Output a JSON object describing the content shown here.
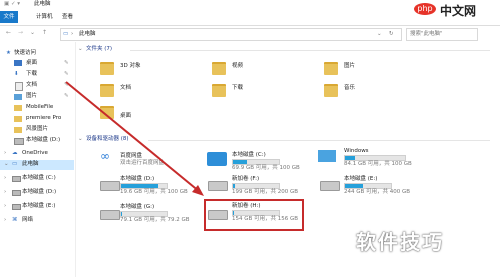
{
  "window": {
    "title": "此电脑",
    "controls": [
      "—",
      "□",
      "✕"
    ]
  },
  "ribbon": {
    "tabs": [
      "文件",
      "计算机",
      "查看"
    ]
  },
  "address": {
    "path": "此电脑",
    "search_placeholder": "搜索\"此电脑\""
  },
  "sidebar": {
    "quick_access": "快速访问",
    "items": [
      "桌面",
      "下载",
      "文档",
      "图片",
      "MobileFile",
      "premiere Pro",
      "风景图片",
      "本地磁盘 (D:)"
    ],
    "onedrive": "OneDrive",
    "this_pc": "此电脑",
    "drives": [
      "本地磁盘 (C:)",
      "本地磁盘 (D:)",
      "本地磁盘 (E:)"
    ],
    "network": "网络"
  },
  "folders_section": "文件夹 (7)",
  "folders": [
    {
      "name": "3D 对象"
    },
    {
      "name": "视频"
    },
    {
      "name": "图片"
    },
    {
      "name": "文档"
    },
    {
      "name": "下载"
    },
    {
      "name": "音乐"
    },
    {
      "name": "桌面"
    }
  ],
  "devices_section": "设备和驱动器 (8)",
  "devices": [
    {
      "name": "百度网盘",
      "sub": "双击运行百度网盘"
    },
    {
      "name": "本地磁盘 (C:)",
      "free": "69.9 GB 可用，共 100 GB",
      "fill": 0.3
    },
    {
      "name": "Windows",
      "free": "84.1 GB 可用，共 100 GB",
      "fill": 0.16
    },
    {
      "name": "本地磁盘 (D:)",
      "free": "19.6 GB 可用，共 100 GB",
      "fill": 0.8
    },
    {
      "name": "新加卷 (F:)",
      "free": "199 GB 可用，共 200 GB",
      "fill": 0.05
    },
    {
      "name": "本地磁盘 (E:)",
      "free": "244 GB 可用，共 400 GB",
      "fill": 0.39
    },
    {
      "name": "本地磁盘 (G:)",
      "free": "79.1 GB 可用，共 79.2 GB",
      "fill": 0.01
    },
    {
      "name": "新加卷 (H:)",
      "free": "154 GB 可用，共 156 GB",
      "fill": 0.01
    }
  ],
  "watermark": {
    "logo": "php中文网",
    "text": "软件技巧"
  }
}
